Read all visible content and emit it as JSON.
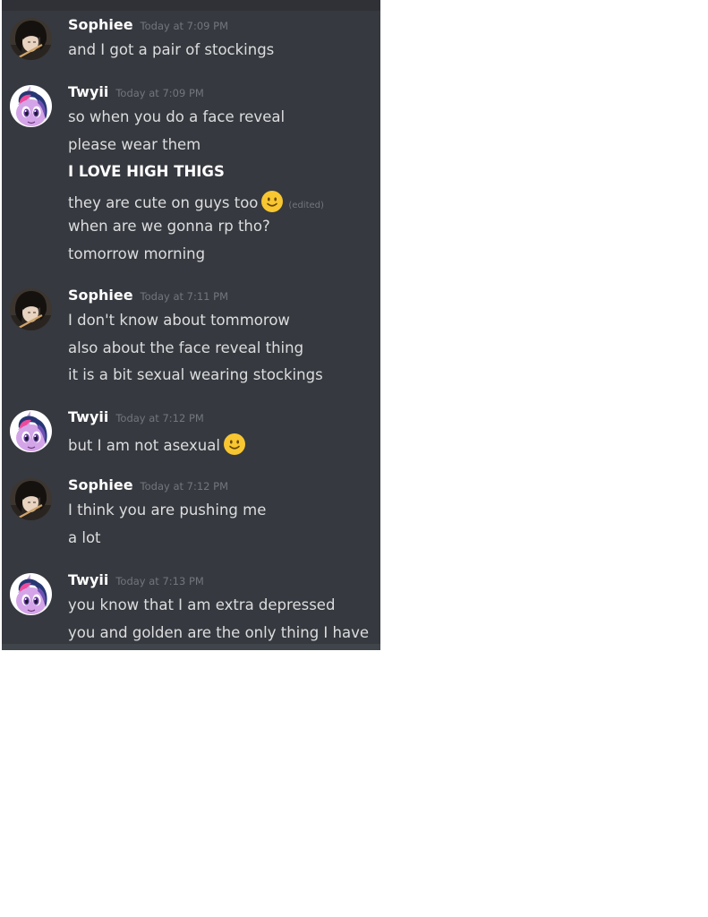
{
  "messages": [
    {
      "author": "Sophiee",
      "timestamp": "Today at 7:09 PM",
      "avatar": "sophiee-avatar",
      "lines": [
        {
          "text": "and I got a pair of stockings"
        }
      ]
    },
    {
      "author": "Twyii",
      "timestamp": "Today at 7:09 PM",
      "avatar": "twyii-avatar",
      "lines": [
        {
          "text": "so when you do a face reveal"
        },
        {
          "text": "please wear them"
        },
        {
          "text": "I LOVE HIGH THIGS",
          "bold": true
        },
        {
          "text": "they are cute on guys too",
          "emoji": "slightly-smiling-face-emoji",
          "edited": "(edited)"
        },
        {
          "text": "when are we gonna rp tho?"
        },
        {
          "text": "tomorrow morning"
        }
      ]
    },
    {
      "author": "Sophiee",
      "timestamp": "Today at 7:11 PM",
      "avatar": "sophiee-avatar",
      "lines": [
        {
          "text": "I don't know about tommorow"
        },
        {
          "text": "also about the face reveal thing"
        },
        {
          "text": "it is a bit sexual wearing stockings"
        }
      ]
    },
    {
      "author": "Twyii",
      "timestamp": "Today at 7:12 PM",
      "avatar": "twyii-avatar",
      "lines": [
        {
          "text": "but I am not asexual",
          "emoji": "slightly-smiling-face-emoji"
        }
      ]
    },
    {
      "author": "Sophiee",
      "timestamp": "Today at 7:12 PM",
      "avatar": "sophiee-avatar",
      "lines": [
        {
          "text": "I think you are pushing me"
        },
        {
          "text": "a lot"
        }
      ]
    },
    {
      "author": "Twyii",
      "timestamp": "Today at 7:13 PM",
      "avatar": "twyii-avatar",
      "lines": [
        {
          "text": "you know that I am extra depressed"
        },
        {
          "text": "you and golden are the only thing I have"
        }
      ]
    }
  ],
  "colors": {
    "background": "#36393f",
    "username": "#ffffff",
    "message_text": "#dcddde",
    "timestamp": "#72767d",
    "emoji": "#f7c631"
  }
}
